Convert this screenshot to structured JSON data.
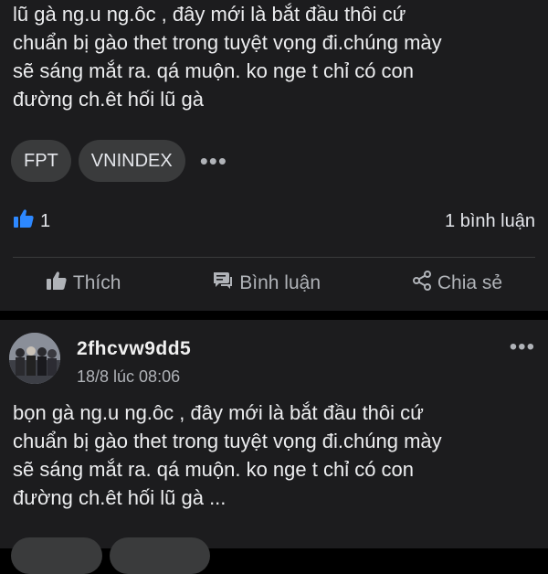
{
  "post1": {
    "text": "lũ gà ng.u ng.ôc , đây mới là bắt đầu thôi cứ\nchuẩn bị gào thet trong tuyệt vọng đi.chúng mày\nsẽ sáng mắt ra. qá muộn. ko nge t chỉ có con\nđường ch.êt hối lũ gà",
    "tags": [
      "FPT",
      "VNINDEX"
    ],
    "more": "•••",
    "likes": "1",
    "comments": "1 bình luận",
    "actions": {
      "like": "Thích",
      "comment": "Bình luận",
      "share": "Chia sẻ"
    }
  },
  "post2": {
    "author": "2fhcvw9dd5",
    "time": "18/8 lúc 08:06",
    "menu": "•••",
    "text": "bọn gà ng.u ng.ôc , đây mới là bắt đầu thôi cứ\nchuẩn bị gào thet trong tuyệt vọng đi.chúng mày\nsẽ sáng mắt ra. qá muộn. ko nge t chỉ có con\nđường ch.êt hối lũ gà ..."
  },
  "colors": {
    "like_blue": "#2d88ff",
    "card": "#1c1c1e",
    "tag_bg": "#3a3b3c"
  }
}
